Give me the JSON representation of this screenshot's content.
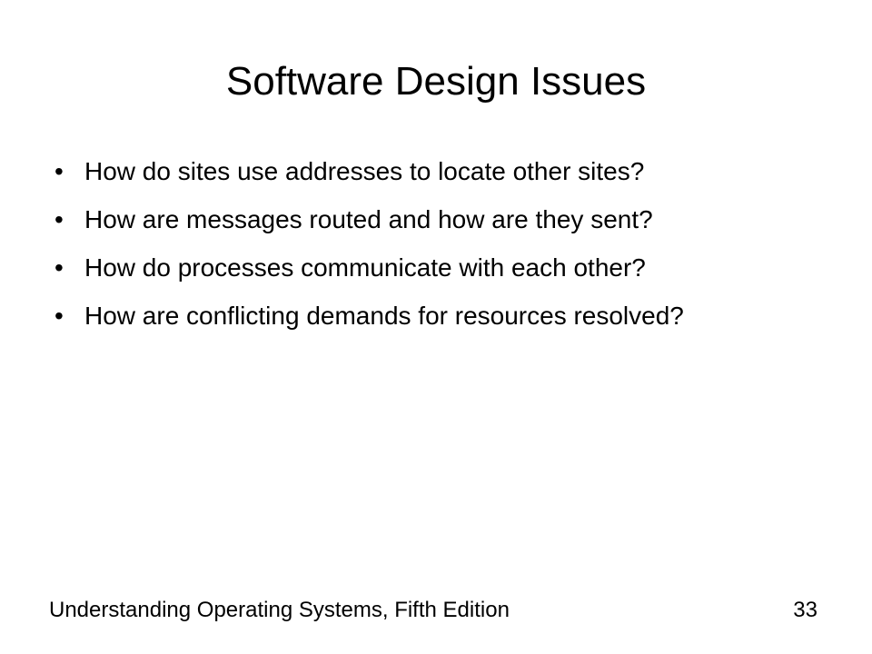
{
  "slide": {
    "title": "Software Design Issues",
    "bullet_marker": "•",
    "bullets": [
      "How do sites use addresses to locate other sites?",
      "How are messages routed and how are they sent?",
      "How do processes communicate with each other?",
      "How are conflicting demands for resources resolved?"
    ]
  },
  "footer": {
    "source": "Understanding Operating Systems, Fifth Edition",
    "page_number": "33"
  }
}
